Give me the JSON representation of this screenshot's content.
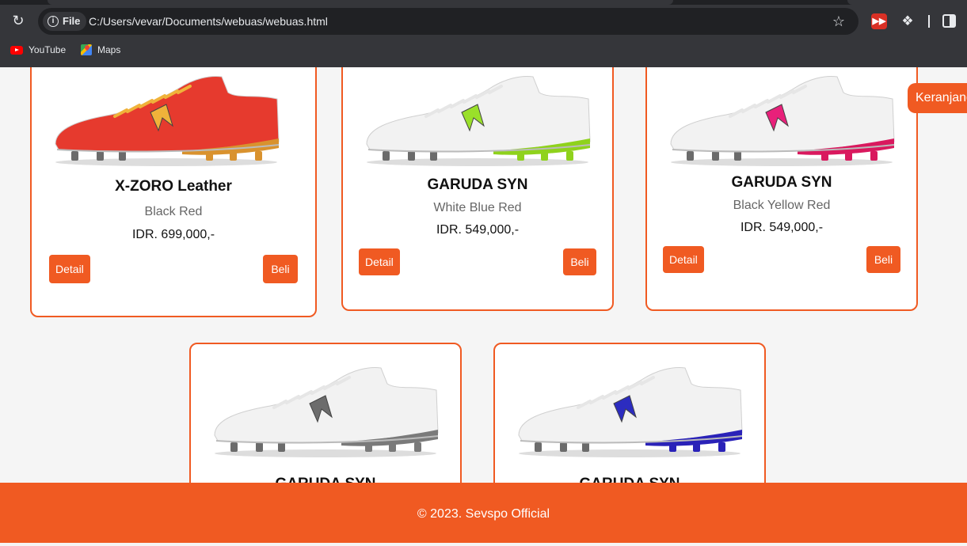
{
  "browser": {
    "chip_label": "File",
    "url": "C:/Users/vevar/Documents/webuas/webuas.html",
    "bookmarks": [
      {
        "label": "YouTube",
        "icon": "youtube-icon"
      },
      {
        "label": "Maps",
        "icon": "maps-icon"
      }
    ]
  },
  "cart": {
    "label": "Keranjang"
  },
  "buttons": {
    "detail": "Detail",
    "buy": "Beli"
  },
  "products": [
    {
      "name": "X-ZORO Leather",
      "variant": "Black Red",
      "price": "IDR. 699,000,-",
      "upper_color": "#e63a2e",
      "accent_color": "#f0b23a",
      "sole_color": "#d9922e"
    },
    {
      "name": "GARUDA SYN",
      "variant": "White Blue Red",
      "price": "IDR. 549,000,-",
      "upper_color": "#f2f2f2",
      "accent_color": "#9ae02a",
      "sole_color": "#8fd21c"
    },
    {
      "name": "GARUDA SYN",
      "variant": "Black Yellow Red",
      "price": "IDR. 549,000,-",
      "upper_color": "#f2f2f2",
      "accent_color": "#e8207a",
      "sole_color": "#d9195e"
    },
    {
      "name": "GARUDA SYN",
      "variant": "",
      "price": "",
      "upper_color": "#f2f2f2",
      "accent_color": "#6c6c6c",
      "sole_color": "#7a7a7a"
    },
    {
      "name": "GARUDA SYN",
      "variant": "",
      "price": "",
      "upper_color": "#f2f2f2",
      "accent_color": "#2c2cc0",
      "sole_color": "#2a22b8"
    }
  ],
  "footer": {
    "copyright": "© 2023. Sevspo Official"
  },
  "colors": {
    "accent": "#f05a22",
    "chrome_bg": "#35363a",
    "page_bg": "#f5f5f5"
  }
}
